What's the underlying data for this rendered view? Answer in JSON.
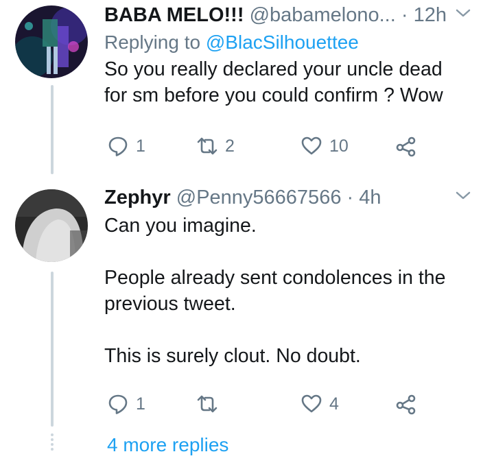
{
  "tweets": [
    {
      "display_name": "BABA MELO!!!",
      "handle": "@babamelono...",
      "separator": "·",
      "time": "12h",
      "replying_prefix": "Replying to",
      "replying_to": "@BlacSilhouettee",
      "lines": [
        "So you really declared your uncle dead",
        "for sm before you could confirm ? Wow"
      ],
      "replies": "1",
      "retweets": "2",
      "likes": "10"
    },
    {
      "display_name": "Zephyr",
      "handle": "@Penny56667566",
      "separator": "·",
      "time": "4h",
      "lines": [
        "Can you imagine.",
        "",
        "People already sent condolences in the",
        "previous tweet.",
        "",
        "This is surely clout. No doubt."
      ],
      "replies": "1",
      "retweets": "",
      "likes": "4"
    }
  ],
  "more_replies": "4 more replies",
  "icons": {
    "reply": "reply-icon",
    "retweet": "retweet-icon",
    "like": "heart-icon",
    "share": "share-icon",
    "menu": "chevron-down-icon"
  },
  "colors": {
    "text": "#14171a",
    "muted": "#657786",
    "link": "#1da1f2",
    "thread": "#ccd6dd"
  }
}
